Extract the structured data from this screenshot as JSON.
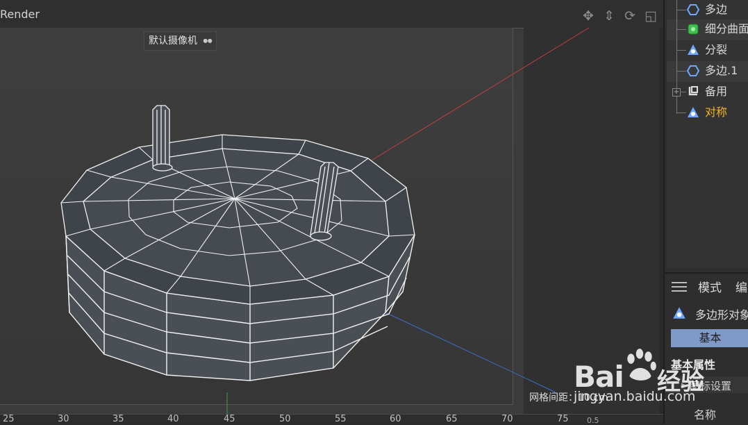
{
  "viewport": {
    "title": "Render",
    "camera_label": "默认摄像机",
    "camera_icon": "camera-icon",
    "nav_icons": [
      "move-icon",
      "zoom-icon",
      "rotate-icon",
      "maximize-icon"
    ],
    "grid_spacing": "网格间距：10 cm",
    "ruler_ticks": [
      "25",
      "30",
      "35",
      "40",
      "45",
      "50",
      "55",
      "60",
      "65",
      "70",
      "75"
    ],
    "ruler_value": "0.5"
  },
  "object_tree": {
    "items": [
      {
        "label": "多边",
        "icon": "polygon-icon",
        "active": false
      },
      {
        "label": "细分曲面",
        "icon": "subdivision-surface-icon",
        "active": false
      },
      {
        "label": "分裂",
        "icon": "split-icon",
        "active": false
      },
      {
        "label": "多边.1",
        "icon": "polygon-icon",
        "active": false
      },
      {
        "label": "备用",
        "icon": "null-object-icon",
        "active": false
      },
      {
        "label": "对称",
        "icon": "symmetry-icon",
        "active": true
      }
    ]
  },
  "attributes": {
    "tabs": [
      "模式",
      "编"
    ],
    "object_type": "多边形对象",
    "basic_button": "基本",
    "section_title": "基本属性",
    "sub_section": "图标设置",
    "name_label": "名称"
  },
  "watermark": {
    "brand": "Bai",
    "brand_cn": "经验",
    "url": "jingyan.baidu.com"
  },
  "colors": {
    "active_item": "#f5b32a",
    "basic_button": "#7f99c9",
    "axis_x": "#c04040",
    "axis_z": "#3a6fc8",
    "axis_y": "#3ca04a"
  }
}
